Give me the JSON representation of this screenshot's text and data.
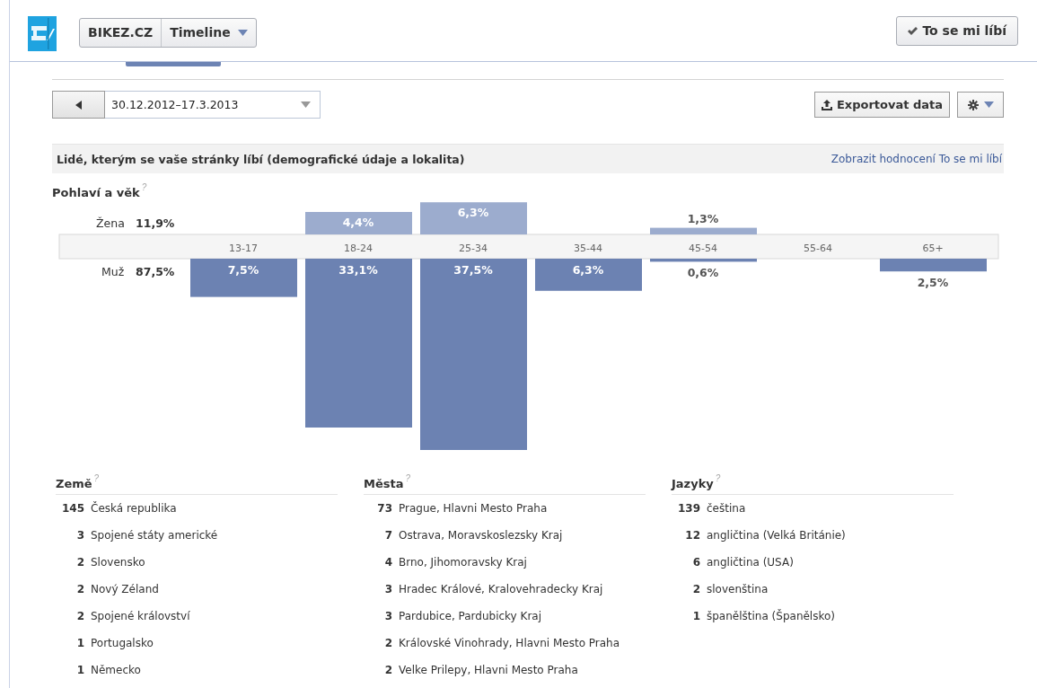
{
  "header": {
    "page_name": "BIKEZ.CZ",
    "menu": "Timeline",
    "like_button": "To se mi líbí"
  },
  "toolbar": {
    "date_range": "30.12.2012–17.3.2013",
    "export_button": "Exportovat data"
  },
  "section": {
    "title": "Lidé, kterým se vaše stránky líbí (demografické údaje a lokalita)",
    "link": "Zobrazit hodnocení To se mi líbí"
  },
  "gender_age": {
    "title": "Pohlaví a věk",
    "help": "?",
    "female": {
      "label": "Žena",
      "total": "11,9%",
      "color": "#9cacce"
    },
    "male": {
      "label": "Muž",
      "total": "87,5%",
      "color": "#6c82b2"
    },
    "age_groups": [
      {
        "label": "13-17",
        "male": "7,5%"
      },
      {
        "label": "18-24",
        "female": "4,4%",
        "male": "33,1%"
      },
      {
        "label": "25-34",
        "female": "6,3%",
        "male": "37,5%"
      },
      {
        "label": "35-44",
        "male": "6,3%"
      },
      {
        "label": "45-54",
        "female": "1,3%",
        "male": "0,6%"
      },
      {
        "label": "55-64"
      },
      {
        "label": "65+",
        "male": "2,5%"
      }
    ]
  },
  "lists": [
    {
      "title": "Země",
      "help": "?",
      "rows": [
        {
          "count": "145",
          "name": "Česká republika"
        },
        {
          "count": "3",
          "name": "Spojené státy americké"
        },
        {
          "count": "2",
          "name": "Slovensko"
        },
        {
          "count": "2",
          "name": "Nový Zéland"
        },
        {
          "count": "2",
          "name": "Spojené království"
        },
        {
          "count": "1",
          "name": "Portugalsko"
        },
        {
          "count": "1",
          "name": "Německo"
        }
      ]
    },
    {
      "title": "Města",
      "help": "?",
      "rows": [
        {
          "count": "73",
          "name": "Prague, Hlavni Mesto Praha"
        },
        {
          "count": "7",
          "name": "Ostrava, Moravskoslezsky Kraj"
        },
        {
          "count": "4",
          "name": "Brno, Jihomoravsky Kraj"
        },
        {
          "count": "3",
          "name": "Hradec Králové, Kralovehradecky Kraj"
        },
        {
          "count": "3",
          "name": "Pardubice, Pardubicky Kraj"
        },
        {
          "count": "2",
          "name": "Královské Vinohrady, Hlavni Mesto Praha"
        },
        {
          "count": "2",
          "name": "Velke Prilepy, Hlavni Mesto Praha"
        }
      ]
    },
    {
      "title": "Jazyky",
      "help": "?",
      "rows": [
        {
          "count": "139",
          "name": "čeština"
        },
        {
          "count": "12",
          "name": "angličtina (Velká Británie)"
        },
        {
          "count": "6",
          "name": "angličtina (USA)"
        },
        {
          "count": "2",
          "name": "slovenština"
        },
        {
          "count": "1",
          "name": "španělština (Španělsko)"
        }
      ]
    }
  ]
}
